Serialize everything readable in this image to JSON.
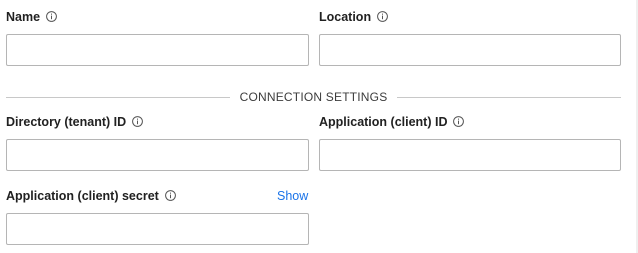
{
  "fields": {
    "name": {
      "label": "Name",
      "value": ""
    },
    "location": {
      "label": "Location",
      "value": ""
    },
    "tenant_id": {
      "label": "Directory (tenant) ID",
      "value": ""
    },
    "client_id": {
      "label": "Application (client) ID",
      "value": ""
    },
    "client_secret": {
      "label": "Application (client) secret",
      "value": "",
      "show_label": "Show"
    }
  },
  "section": {
    "title": "CONNECTION SETTINGS"
  },
  "icons": {
    "info": "info-circle-icon"
  },
  "colors": {
    "link": "#1a73e8",
    "border": "#b5b5b5",
    "divider": "#c8c8c8",
    "text": "#212121"
  }
}
